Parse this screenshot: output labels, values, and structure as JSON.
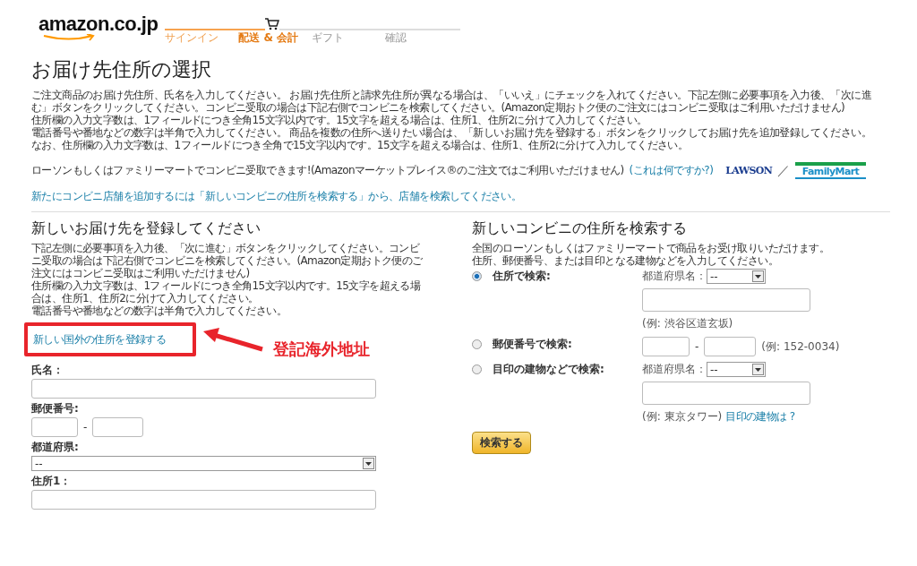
{
  "header": {
    "logo": "amazon.co.jp",
    "steps": [
      {
        "label": "サインイン",
        "completed": true,
        "selected": false
      },
      {
        "label": "配送 & 会計",
        "completed": false,
        "selected": true
      },
      {
        "label": "ギフト",
        "completed": false,
        "selected": false
      },
      {
        "label": "確認",
        "completed": false,
        "selected": false
      }
    ]
  },
  "title": "お届け先住所の選択",
  "intro": [
    "ご注文商品のお届け先住所、氏名を入力してください。 お届け先住所と請求先住所が異なる場合は、「いいえ」にチェックを入れてください。下記左側に必要事項を入力後、「次に進む」ボタンをクリックしてください。コンビニ受取の場合は下記右側でコンビニを検索してください。(Amazon定期おトク便のご注文にはコンビニ受取はご利用いただけません)",
    "住所欄の入力文字数は、1フィールドにつき全角15文字以内です。15文字を超える場合は、住所1、住所2に分けて入力してください。",
    "電話番号や番地などの数字は半角で入力してください。 商品を複数の住所へ送りたい場合は、「新しいお届け先を登録する」ボタンをクリックしてお届け先を追加登録してください。",
    "なお、住所欄の入力文字数は、1フィールドにつき全角で15文字以内です。15文字を超える場合は、住所1、住所2に分けて入力してください。"
  ],
  "konbini": {
    "text": "ローソンもしくはファミリーマートでコンビニ受取できます!(Amazonマーケットプレイス®のご注文ではご利用いただけません)",
    "help_link": "(これは何ですか?)",
    "lawson": "LAWSON",
    "separator": "／",
    "familymart": "FamilyMart",
    "note": "新たにコンビニ店舗を追加するには「新しいコンビニの住所を検索する」から、店舗を検索してください。"
  },
  "new_address": {
    "heading": "新しいお届け先を登録してください",
    "paragraphs": [
      "下記左側に必要事項を入力後、「次に進む」ボタンをクリックしてください。コンビニ受取の場合は下記右側でコンビニを検索してください。(Amazon定期おトク便のご注文にはコンビニ受取はご利用いただけません)",
      "住所欄の入力文字数は、1フィールドにつき全角15文字以内です。15文字を超える場合は、住所1、住所2に分けて入力してください。",
      "電話番号や番地などの数字は半角で入力してください。"
    ],
    "foreign_link": "新しい国外の住所を登録する",
    "annotation": "登記海外地址",
    "fields": [
      {
        "kind": "text",
        "label": "氏名："
      },
      {
        "kind": "postal",
        "label": "郵便番号:",
        "separator": "-"
      },
      {
        "kind": "select",
        "label": "都道府県:",
        "value": "--"
      },
      {
        "kind": "text",
        "label": "住所1："
      }
    ]
  },
  "konbini_search": {
    "heading": "新しいコンビニの住所を検索する",
    "lines": [
      "全国のローソンもしくはファミリーマートで商品をお受け取りいただけます。",
      "住所、郵便番号、または目印となる建物などを入力してください。"
    ],
    "options": [
      {
        "kind": "address",
        "label": "住所で検索:",
        "selected": true,
        "pref_label": "都道府県名：",
        "pref_value": "--",
        "example": "(例: 渋谷区道玄坂)"
      },
      {
        "kind": "postal",
        "label": "郵便番号で検索:",
        "selected": false,
        "separator": "-",
        "example": "(例: 152-0034)"
      },
      {
        "kind": "landmark",
        "label": "目印の建物などで検索:",
        "selected": false,
        "pref_label": "都道府県名：",
        "pref_value": "--",
        "example": "(例: 東京タワー)",
        "link": "目印の建物は ?"
      }
    ],
    "button": "検索する"
  }
}
